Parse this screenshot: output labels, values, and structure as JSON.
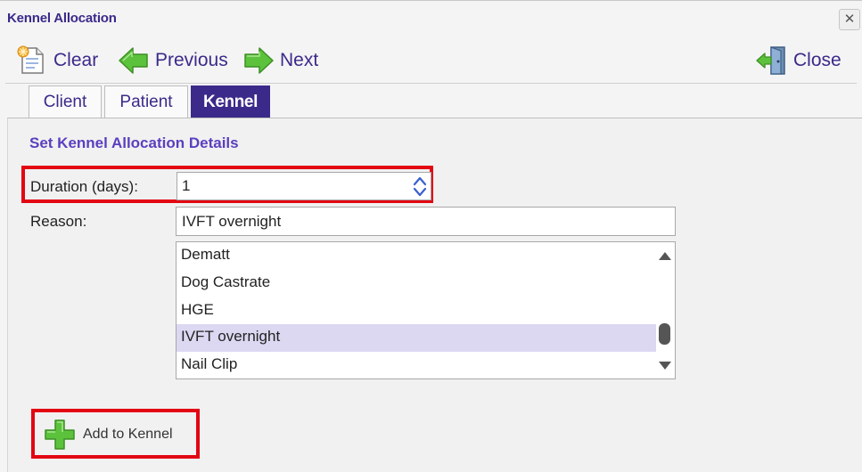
{
  "window": {
    "title": "Kennel Allocation",
    "close_glyph": "✕"
  },
  "toolbar": {
    "clear_label": "Clear",
    "previous_label": "Previous",
    "next_label": "Next",
    "close_label": "Close",
    "icons": {
      "clear": "clear-document-icon",
      "previous": "arrow-left-icon",
      "next": "arrow-right-icon",
      "close": "exit-door-icon"
    }
  },
  "tabs": [
    {
      "label": "Client",
      "active": false
    },
    {
      "label": "Patient",
      "active": false
    },
    {
      "label": "Kennel",
      "active": true
    }
  ],
  "form": {
    "section_title": "Set Kennel Allocation Details",
    "duration_label": "Duration (days):",
    "duration_value": "1",
    "reason_label": "Reason:",
    "reason_value": "IVFT overnight",
    "reason_options": [
      "Dematt",
      "Dog Castrate",
      "HGE",
      "IVFT overnight",
      "Nail Clip"
    ],
    "selected_option": "IVFT overnight"
  },
  "actions": {
    "add_label": "Add to Kennel",
    "add_icon": "plus-icon"
  },
  "colors": {
    "brand": "#3b2a8a",
    "section_title": "#5b3fbf",
    "highlight": "#e30613",
    "selection": "#dcd8f2",
    "icon_green": "#5cc23c"
  }
}
